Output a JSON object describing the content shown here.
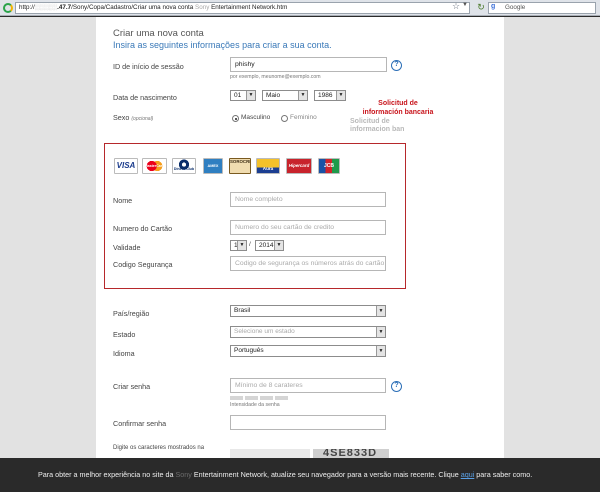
{
  "browser": {
    "url_prefix": "http://",
    "url_host_blur": "░░░░░",
    "url_host_bold": ".47.7",
    "url_path": "/Sony/Copa/Cadastro/Criar uma nova conta",
    "url_brand_blur": "Sony",
    "url_suffix": " Entertainment Network.htm",
    "search_placeholder": "Google",
    "search_engine_icon": "g-icon",
    "bookmark_icon": "star-icon",
    "reload_icon": "reload-icon"
  },
  "form": {
    "title": "Criar uma nova conta",
    "subtitle": "Insira as seguintes informações para criar a sua conta.",
    "signin_id": {
      "label": "ID de início de sessão",
      "value": "phishy",
      "hint": "por exemplo, meunome@exemplo.com"
    },
    "birth_date": {
      "label": "Data de nascimento",
      "day": "01",
      "month": "Maio",
      "year": "1986"
    },
    "gender": {
      "label": "Sexo",
      "optional": "(opcional)",
      "male": "Masculino",
      "female": "Feminino"
    },
    "card_logos": [
      "VISA",
      "MasterCard",
      "Diners Club",
      "AMEX",
      "SOROCRED",
      "Aura",
      "Hipercard",
      "JCB"
    ],
    "card_name": {
      "label": "Nome",
      "placeholder": "Nome completo"
    },
    "card_number": {
      "label": "Numero do Cartão",
      "placeholder": "Numero do seu cartão de credito"
    },
    "validity": {
      "label": "Validade",
      "month": "1",
      "year": "2014",
      "sep": "/"
    },
    "security_code": {
      "label": "Codigo Segurança",
      "placeholder": "Codigo de segurança os números atrás do cartão"
    },
    "country": {
      "label": "País/região",
      "value": "Brasil"
    },
    "state": {
      "label": "Estado",
      "placeholder": "Selecione um estado"
    },
    "language": {
      "label": "Idioma",
      "value": "Português"
    },
    "password": {
      "label": "Criar senha",
      "placeholder": "Mínimo de 8 carateres",
      "strength_label": "Intensidade da senha"
    },
    "confirm_password": {
      "label": "Confirmar senha"
    },
    "captcha": {
      "label": "Digite os caracteres mostrados na",
      "text": "4SE833D"
    }
  },
  "annotation": {
    "line1": "Solicitud de",
    "line2": "información bancaria",
    "ghost1": "Solicitud de",
    "ghost2": "informacion ban"
  },
  "notice": {
    "prefix": "Para obter a melhor experiência no site da ",
    "brand_blur": "Sony",
    "middle": " Entertainment Network, atualize seu navegador para a versão mais recente. Clique ",
    "link": "aqui",
    "suffix": " para saber como."
  },
  "colors": {
    "link": "#3a79b8",
    "highlight": "#b6282b",
    "annotation": "#c8141c"
  }
}
